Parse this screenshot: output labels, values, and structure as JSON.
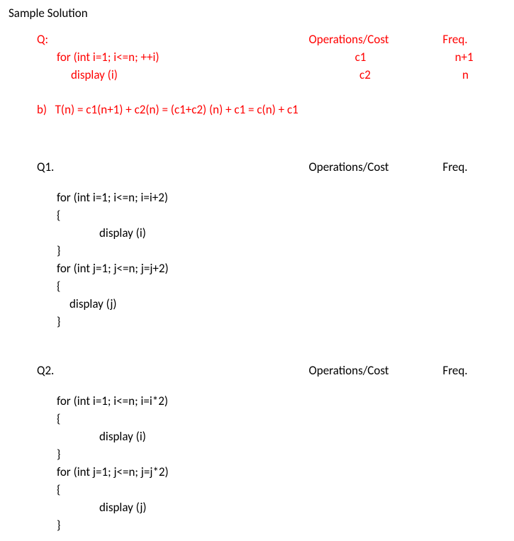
{
  "title": "Sample Solution",
  "example": {
    "label": "Q:",
    "ops_header": "Operations/Cost",
    "freq_header": "Freq.",
    "line1": {
      "code": "for (int i=1; i<=n; ++i)",
      "ops": "c1",
      "freq": "n+1"
    },
    "line2": {
      "code": "display (i)",
      "ops": "c2",
      "freq": "n"
    },
    "partb_label": "b)",
    "partb_text": "T(n) = c1(n+1) + c2(n) = (c1+c2) (n) + c1 = c(n) + c1"
  },
  "q1": {
    "label": "Q1.",
    "ops_header": "Operations/Cost",
    "freq_header": "Freq.",
    "code": {
      "l1": "for (int i=1; i<=n; i=i+2)",
      "l2": "{",
      "l3": "display (i)",
      "l4": "}",
      "l5": "for (int j=1; j<=n; j=j+2)",
      "l6": "{",
      "l7": "display (j)",
      "l8": "}"
    }
  },
  "q2": {
    "label": "Q2.",
    "ops_header": "Operations/Cost",
    "freq_header": "Freq.",
    "code": {
      "l1": "for (int i=1; i<=n; i=i*2)",
      "l2": "{",
      "l3": "display (i)",
      "l4": "}",
      "l5": "for (int j=1; j<=n; j=j*2)",
      "l6": "{",
      "l7": "display (j)",
      "l8": "}"
    }
  }
}
